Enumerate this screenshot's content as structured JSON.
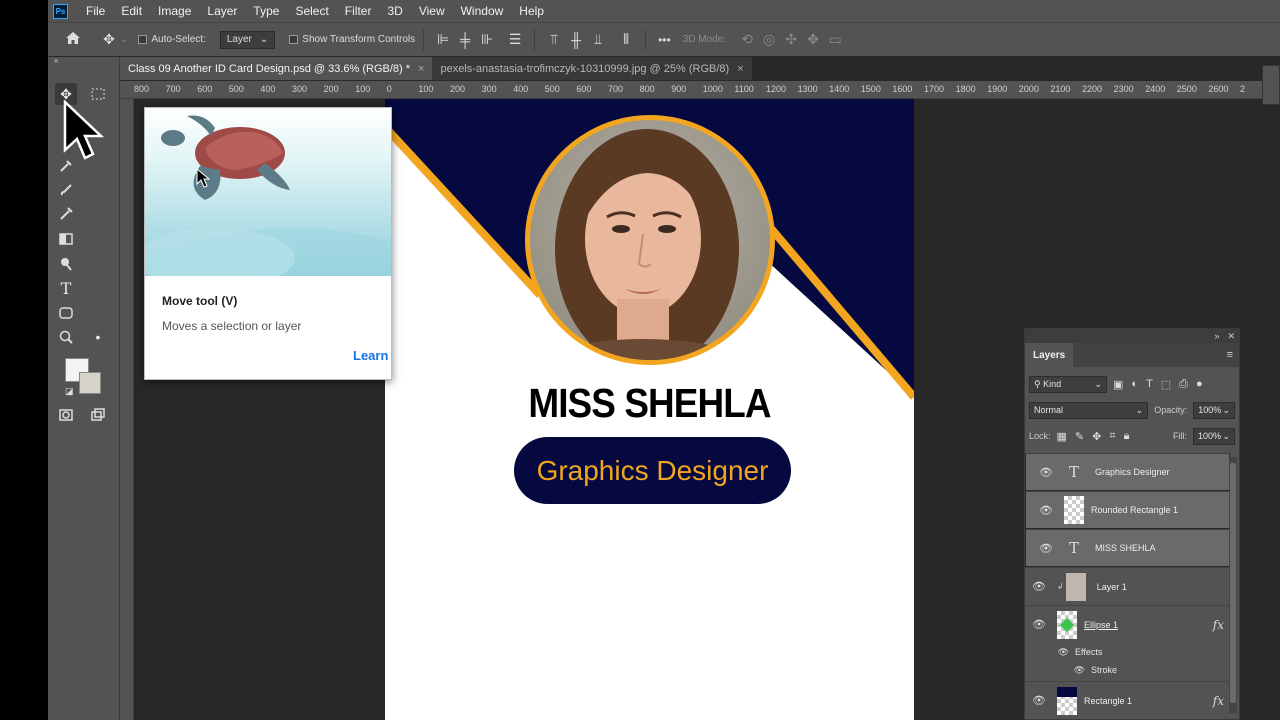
{
  "app": {
    "logo_text": "Ps"
  },
  "menu": [
    "File",
    "Edit",
    "Image",
    "Layer",
    "Type",
    "Select",
    "Filter",
    "3D",
    "View",
    "Window",
    "Help"
  ],
  "options": {
    "auto_select_label": "Auto-Select:",
    "auto_select_value": "Layer",
    "show_transform_label": "Show Transform Controls",
    "mode_3d_label": "3D Mode:",
    "more_label": "•••"
  },
  "tabs": [
    {
      "label": "Class 09 Another ID Card Design.psd @ 33.6% (RGB/8) *",
      "close": "×"
    },
    {
      "label": "pexels-anastasia-trofimczyk-10310999.jpg @ 25% (RGB/8)",
      "close": "×"
    }
  ],
  "ruler_labels": [
    "800",
    "700",
    "600",
    "500",
    "400",
    "300",
    "200",
    "100",
    "0",
    "100",
    "200",
    "300",
    "400",
    "500",
    "600",
    "700",
    "800",
    "900",
    "1000",
    "1100",
    "1200",
    "1300",
    "1400",
    "1500",
    "1600",
    "1700",
    "1800",
    "1900",
    "2000",
    "2100",
    "2200",
    "2300",
    "2400",
    "2500",
    "2600",
    "2"
  ],
  "card": {
    "name": "MISS SHEHLA",
    "title": "Graphics Designer",
    "colors": {
      "navy": "#05093f",
      "gold": "#f2a51f"
    }
  },
  "tooltip": {
    "title": "Move tool (V)",
    "description": "Moves a selection or layer",
    "link": "Learn"
  },
  "layers_panel": {
    "tab": "Layers",
    "menu_icon": "≡",
    "filter_kind": "Kind",
    "blend_mode": "Normal",
    "opacity_label": "Opacity:",
    "opacity_value": "100%",
    "lock_label": "Lock:",
    "fill_label": "Fill:",
    "fill_value": "100%",
    "layers": [
      {
        "name": "Graphics Designer",
        "kind": "text"
      },
      {
        "name": "Rounded Rectangle 1",
        "kind": "shape"
      },
      {
        "name": "MISS SHEHLA",
        "kind": "text"
      },
      {
        "name": "Layer 1",
        "kind": "image"
      },
      {
        "name": "Ellipse 1",
        "kind": "shape",
        "fx": "fx"
      },
      {
        "name": "Effects",
        "kind": "effects"
      },
      {
        "name": "Stroke",
        "kind": "effect"
      },
      {
        "name": "Rectangle 1",
        "kind": "shape",
        "fx": "fx"
      }
    ]
  },
  "tools": [
    "move-tool",
    "marquee-tool",
    "lasso-tool",
    "crop-tool",
    "eyedropper-tool",
    "brush-tool",
    "clone-stamp-tool",
    "eraser-tool",
    "gradient-tool",
    "dodge-tool",
    "pen-tool",
    "type-tool",
    "path-selection-tool",
    "rectangle-tool",
    "zoom-tool",
    "hand-tool",
    "foreground-color",
    "background-color",
    "quick-mask",
    "screen-mode"
  ]
}
